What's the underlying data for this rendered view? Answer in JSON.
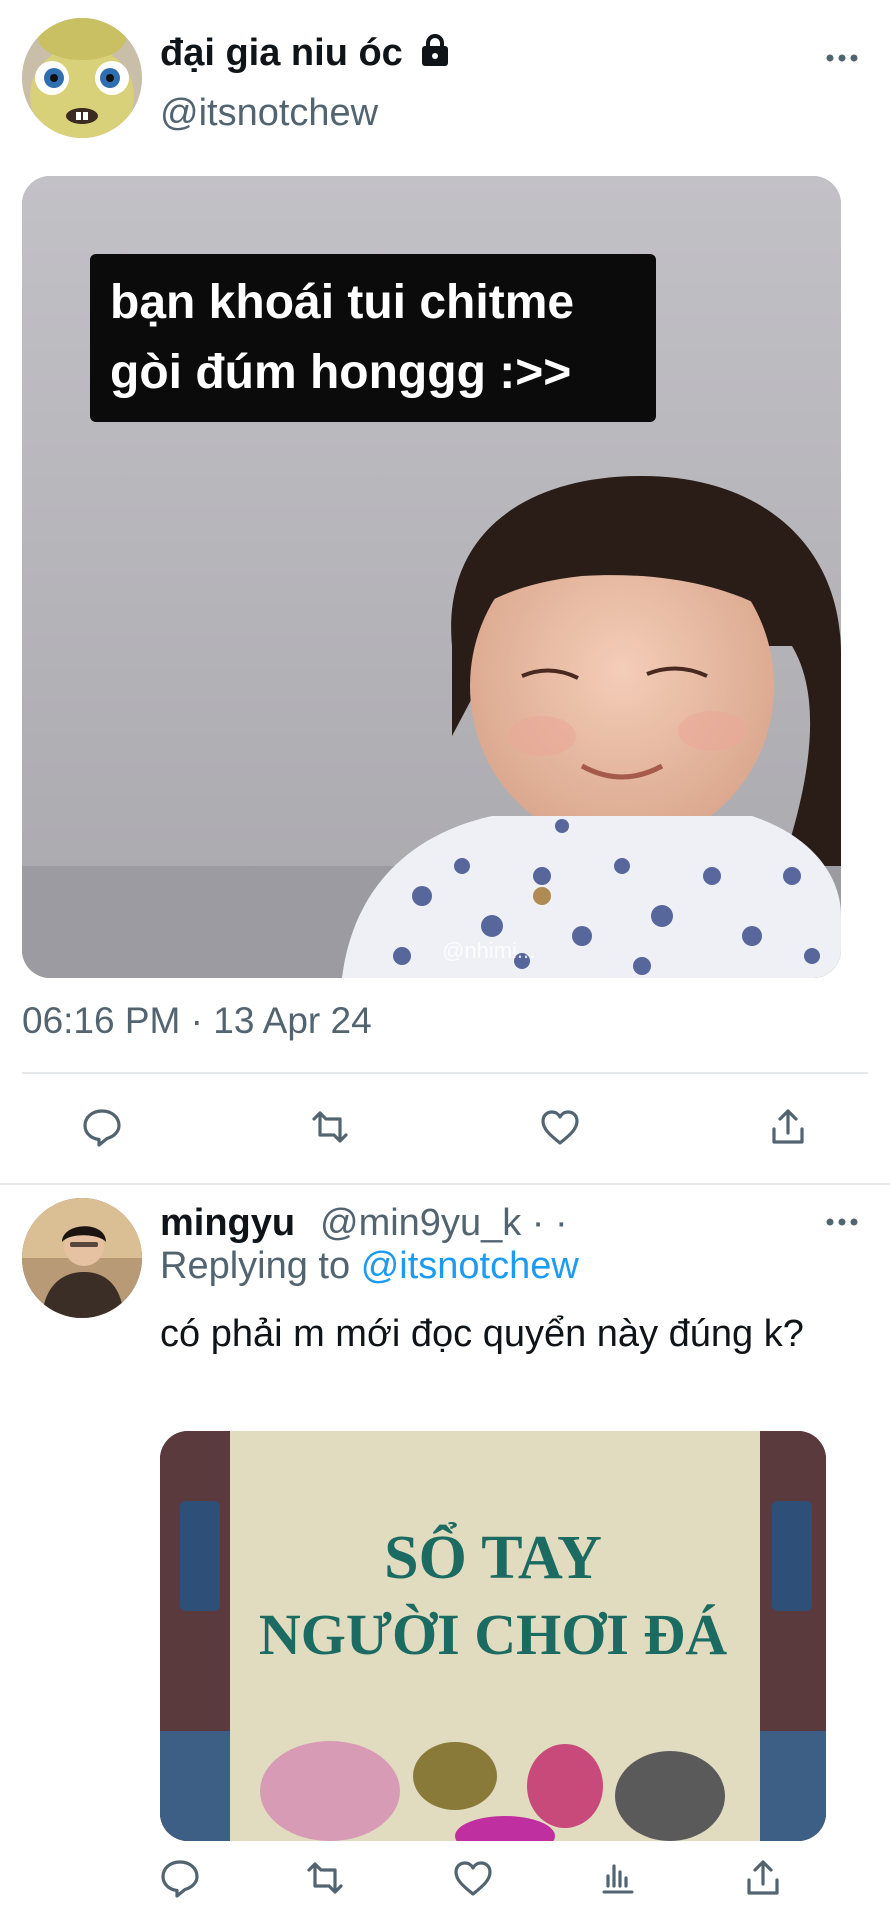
{
  "main_tweet": {
    "display_name": "đại gia niu óc",
    "handle": "@itsnotchew",
    "caption_line1": "bạn khoái tui chitme",
    "caption_line2": "gòi đúm honggg :>>",
    "watermark": "@nhimi...",
    "timestamp": "06:16 PM · 13 Apr 24"
  },
  "reply_tweet": {
    "display_name": "mingyu",
    "handle": "@min9yu_k · ·",
    "replying_prefix": "Replying to",
    "replying_mention": "@itsnotchew",
    "text": "có phải m mới đọc quyển này đúng k?",
    "book_line1": "SỔ TAY",
    "book_line2": "NGƯỜI CHƠI ĐÁ"
  },
  "icons": {
    "lock": "lock-icon",
    "more": "more-icon",
    "reply": "reply-icon",
    "retweet": "retweet-icon",
    "like": "like-icon",
    "views": "views-icon",
    "share": "share-icon"
  },
  "colors": {
    "text": "#0f1419",
    "secondary": "#536471",
    "mention": "#1d9bf0",
    "divider": "#e6e9ec"
  }
}
